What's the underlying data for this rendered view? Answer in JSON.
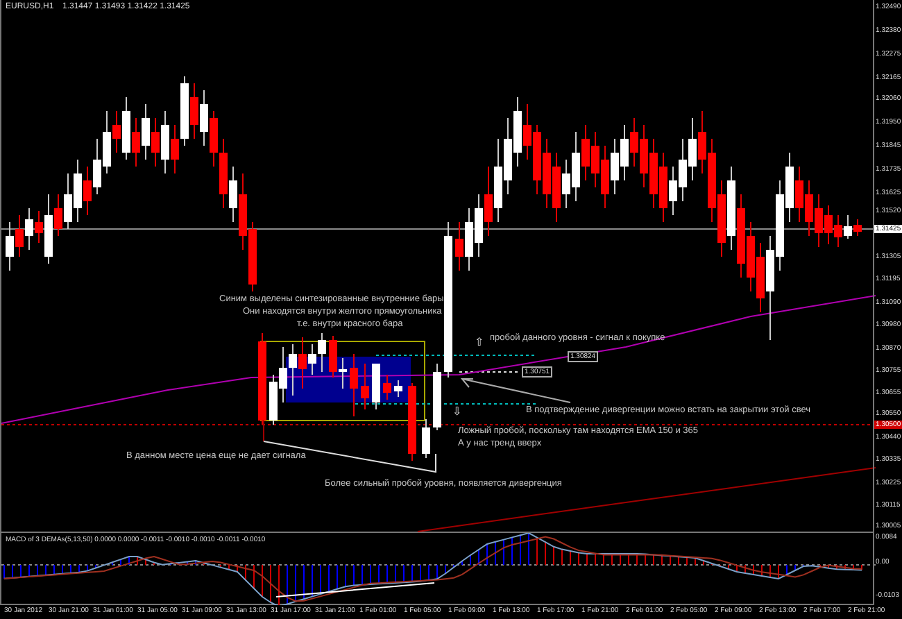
{
  "chart": {
    "symbol": "EURUSD,H1",
    "ohlc": "1.31447 1.31493 1.31422 1.31425",
    "price_axis": [
      "1.32490",
      "1.32380",
      "1.32275",
      "1.32165",
      "1.32060",
      "1.31950",
      "1.31845",
      "1.31735",
      "1.31625",
      "1.31520",
      "1.31305",
      "1.31195",
      "1.31090",
      "1.30980",
      "1.30870",
      "1.30755",
      "1.30655",
      "1.30550",
      "1.30440",
      "1.30335",
      "1.30225",
      "1.30115",
      "1.30005"
    ],
    "current_price": "1.31425",
    "alert_price": "1.30500",
    "level_labels": [
      "1.30824",
      "1.30751"
    ],
    "arrows": [
      "⇧",
      "⇩"
    ],
    "annotations": [
      "Синим выделены синтезированные внутренние бары",
      "Они находятся внутри желтого прямоугольника",
      "т.е. внутри красного бара",
      "пробой данного уровня - сигнал к покупке",
      "В подтверждение дивергенции можно встать на закрытии этой свеч",
      "Ложный пробой, поскольку там находятся EMA 150 и 365",
      "А у нас тренд вверх",
      "В данном месте цена еще не дает сигнала",
      "Более сильный пробой уровня, появляется дивергенция"
    ]
  },
  "indicator": {
    "label": "MACD of 3 DEMAs(5,13,50) 0.0000 0.0000 -0.0011 -0.0010 -0.0010 -0.0011 -0.0010",
    "axis": [
      "0.0084",
      "0.00",
      "-0.0103"
    ]
  },
  "time_axis": [
    "30 Jan 2012",
    "30 Jan 21:00",
    "31 Jan 01:00",
    "31 Jan 05:00",
    "31 Jan 09:00",
    "31 Jan 13:00",
    "31 Jan 17:00",
    "31 Jan 21:00",
    "1 Feb 01:00",
    "1 Feb 05:00",
    "1 Feb 09:00",
    "1 Feb 13:00",
    "1 Feb 17:00",
    "1 Feb 21:00",
    "2 Feb 01:00",
    "2 Feb 05:00",
    "2 Feb 09:00",
    "2 Feb 13:00",
    "2 Feb 17:00",
    "2 Feb 21:00"
  ]
}
